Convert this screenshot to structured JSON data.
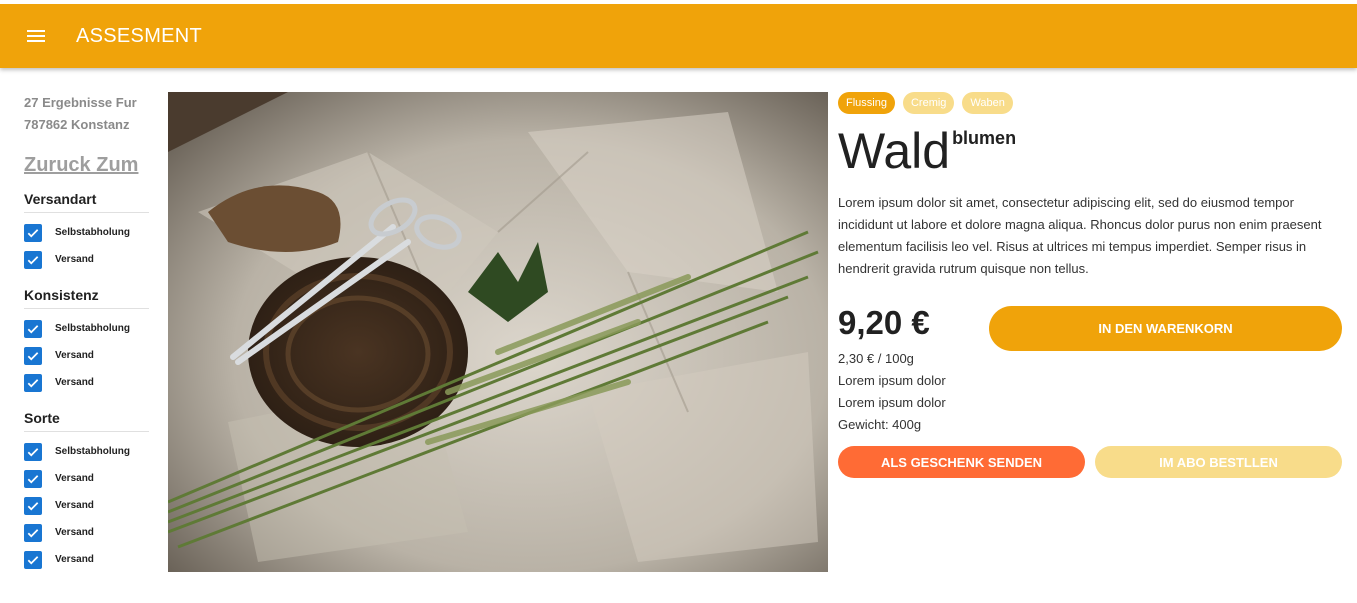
{
  "header": {
    "menu_icon": "menu-icon",
    "title": "ASSESMENT",
    "background": "#f0a30a"
  },
  "sidebar": {
    "results_line1": "27 Ergebnisse Fur",
    "results_line2": "787862 Konstanz",
    "back_link": "Zuruck Zum",
    "groups": [
      {
        "title": "Versandart",
        "items": [
          {
            "label": "Selbstabholung",
            "checked": true
          },
          {
            "label": "Versand",
            "checked": true
          }
        ]
      },
      {
        "title": "Konsistenz",
        "items": [
          {
            "label": "Selbstabholung",
            "checked": true
          },
          {
            "label": "Versand",
            "checked": true
          },
          {
            "label": "Versand",
            "checked": true
          }
        ]
      },
      {
        "title": "Sorte",
        "items": [
          {
            "label": "Selbstabholung",
            "checked": true
          },
          {
            "label": "Versand",
            "checked": true
          },
          {
            "label": "Versand",
            "checked": true
          },
          {
            "label": "Versand",
            "checked": true
          },
          {
            "label": "Versand",
            "checked": true
          }
        ]
      }
    ]
  },
  "product": {
    "chips": [
      {
        "label": "Flussing",
        "active": true
      },
      {
        "label": "Cremig",
        "active": false
      },
      {
        "label": "Waben",
        "active": false
      }
    ],
    "title_main": "Wald",
    "title_sup": "blumen",
    "description": "Lorem ipsum dolor sit amet, consectetur adipiscing elit, sed do eiusmod tempor incididunt ut labore et dolore magna aliqua. Rhoncus dolor purus non enim praesent elementum facilisis leo vel. Risus at ultrices mi tempus imperdiet. Semper risus in hendrerit gravida rutrum quisque non tellus.",
    "price": "9,20 €",
    "unit_price": "2,30 € / 100g",
    "meta1": "Lorem ipsum dolor",
    "meta2": "Lorem ipsum dolor",
    "weight": "Gewicht: 400g",
    "cart_button": "IN DEN WARENKORN",
    "gift_button": "ALS GESCHENK SENDEN",
    "abo_button": "IM ABO BESTLLEN",
    "colors": {
      "primary": "#f0a30a",
      "gift": "#ff6b35",
      "disabled": "#f8dc8a",
      "checkbox": "#1976d2"
    }
  }
}
